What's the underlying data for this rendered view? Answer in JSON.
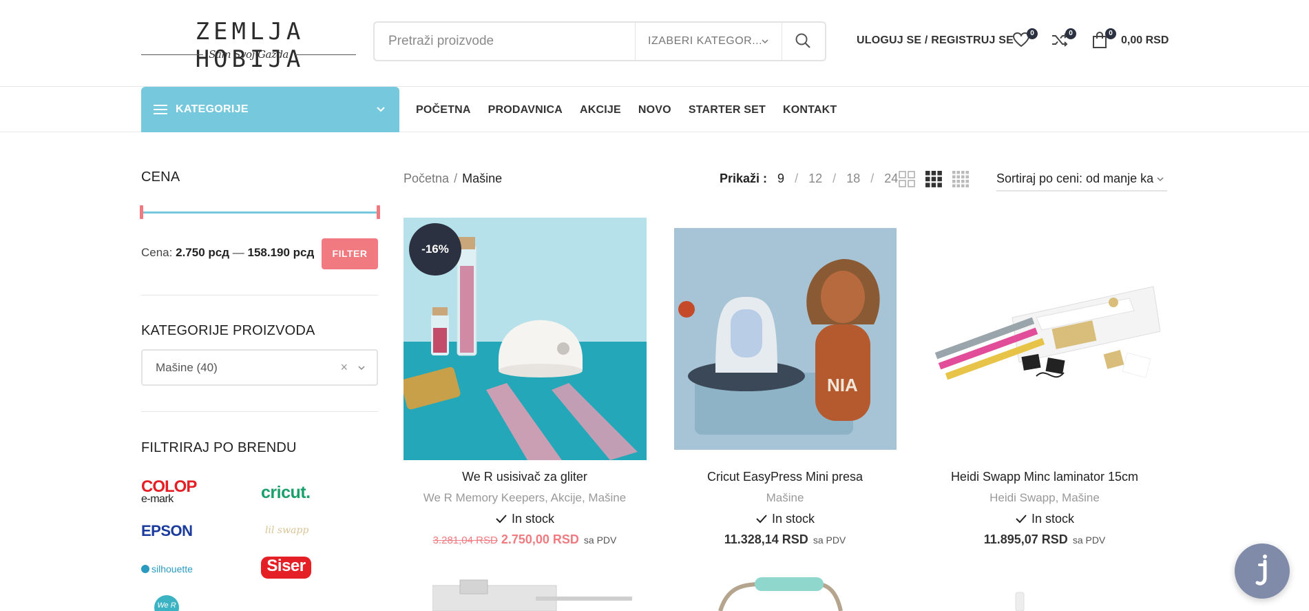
{
  "header": {
    "logo_title": "ZEMLJA HOBIJA",
    "logo_subtitle": "Sam Svoj Gazda",
    "search_placeholder": "Pretraži proizvode",
    "search_category": "IZABERI KATEGOR...",
    "login_label": "ULOGUJ SE / REGISTRUJ SE",
    "wishlist_count": "0",
    "compare_count": "0",
    "cart_count": "0",
    "cart_total": "0,00 RSD"
  },
  "nav": {
    "categories_label": "KATEGORIJE",
    "menu": [
      "POČETNA",
      "PRODAVNICA",
      "AKCIJE",
      "NOVO",
      "STARTER SET",
      "KONTAKT"
    ]
  },
  "sidebar": {
    "price_title": "CENA",
    "price_prefix": "Cena:",
    "price_min": "2.750 рсд",
    "price_dash": "—",
    "price_max": "158.190 рсд",
    "filter_label": "FILTER",
    "categories_title": "KATEGORIJE PROIZVODA",
    "category_selected": "Mašine  (40)",
    "brand_title": "FILTRIRAJ PO BRENDU",
    "brands": {
      "colop_1": "COLOP",
      "colop_2": "e-mark",
      "cricut": "cricut.",
      "epson": "EPSON",
      "lilswapp": "lil swapp",
      "silhouette": "silhouette",
      "siser": "Siser",
      "wer": "We R"
    }
  },
  "toolbar": {
    "breadcrumb_home": "Početna",
    "breadcrumb_sep": "/",
    "breadcrumb_current": "Mašine",
    "per_page_label": "Prikaži :",
    "per_page_options": [
      "9",
      "12",
      "18",
      "24"
    ],
    "per_page_sep": "/",
    "sort_label": "Sortiraj po ceni: od manje ka"
  },
  "products": [
    {
      "name": "We R usisivač za gliter",
      "categories": "We R Memory Keepers, Akcije, Mašine",
      "stock": "In stock",
      "old_price": "3.281,04 RSD",
      "price": "2.750,00 RSD",
      "tax": "sa PDV",
      "badge": "-16%"
    },
    {
      "name": "Cricut EasyPress Mini presa",
      "categories": "Mašine",
      "stock": "In stock",
      "price": "11.328,14 RSD",
      "tax": "sa PDV",
      "tag_text": "NIA"
    },
    {
      "name": "Heidi Swapp Minc laminator 15cm",
      "categories": "Heidi Swapp, Mašine",
      "stock": "In stock",
      "price": "11.895,07 RSD",
      "tax": "sa PDV"
    }
  ],
  "colors": {
    "accent_blue": "#76c9dc",
    "accent_red": "#f07a7f",
    "dark_badge": "#2b3140"
  }
}
